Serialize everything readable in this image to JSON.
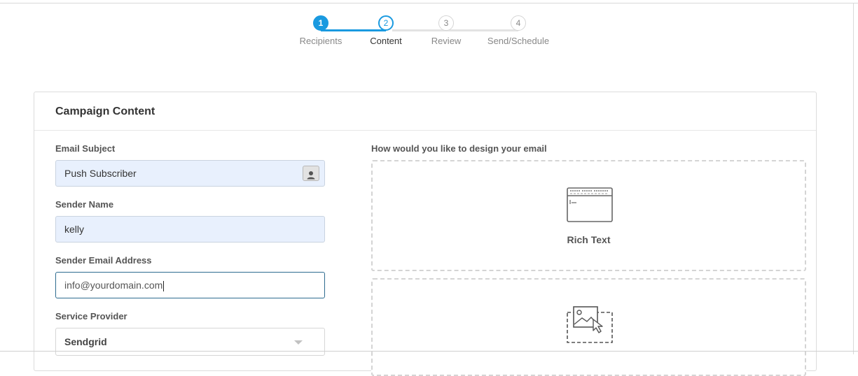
{
  "stepper": {
    "steps": [
      {
        "number": "1",
        "label": "Recipients",
        "state": "done"
      },
      {
        "number": "2",
        "label": "Content",
        "state": "current"
      },
      {
        "number": "3",
        "label": "Review",
        "state": "todo"
      },
      {
        "number": "4",
        "label": "Send/Schedule",
        "state": "todo"
      }
    ],
    "accent_color": "#1a9ae0"
  },
  "card": {
    "title": "Campaign Content"
  },
  "form": {
    "email_subject": {
      "label": "Email Subject",
      "value": "Push Subscriber",
      "personalize_icon": "user-icon"
    },
    "sender_name": {
      "label": "Sender Name",
      "value": "kelly"
    },
    "sender_email": {
      "label": "Sender Email Address",
      "value": "info@yourdomain.com"
    },
    "service_provider": {
      "label": "Service Provider",
      "value": "Sendgrid"
    }
  },
  "design": {
    "prompt": "How would you like to design your email",
    "options": [
      {
        "label": "Rich Text",
        "icon": "rich-text-editor-icon"
      },
      {
        "label": "",
        "icon": "image-select-icon"
      }
    ]
  }
}
